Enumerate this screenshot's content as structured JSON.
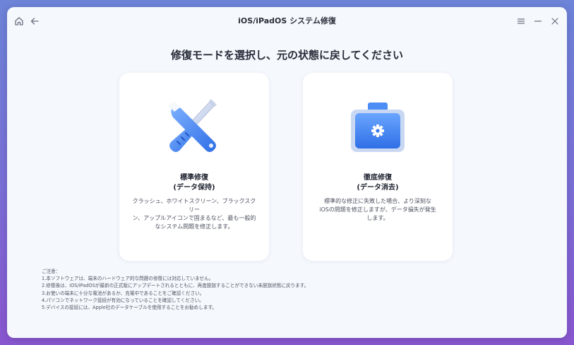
{
  "window": {
    "title": "iOS/iPadOS システム修復"
  },
  "main": {
    "heading": "修復モードを選択し、元の状態に戻してください"
  },
  "cards": [
    {
      "title_line1": "標準修復",
      "title_line2": "(データ保持)",
      "desc_line1": "クラッシュ、ホワイトスクリーン、ブラックスクリー",
      "desc_line2": "ン、アップルアイコンで固まるなど、最も一般的",
      "desc_line3": "なシステム問題を修正します。"
    },
    {
      "title_line1": "徹底修復",
      "title_line2": "(データ消去)",
      "desc_line1": "標準的な修正に失敗した場合、より深刻な",
      "desc_line2": "iOSの問題を修正しますが、データ損失が発生",
      "desc_line3": "します。"
    }
  ],
  "notes": {
    "header": "ご注意：",
    "items": [
      "1.本ソフトウェアは、端末のハードウェア的な問題の修復には対応していません。",
      "2.修復後は、iOS/iPadOSが最新の正式版にアップデートされるとともに、再度脱獄することができない未脱獄状態に戻ります。",
      "3.お使いの端末に十分な電池があるか、充電中であることをご確認ください。",
      "4.パソコンでネットワーク接続が有効になっていることを確認してください。",
      "5.デバイスの接続には、Apple社のデータケーブルを使用することをお勧めします。"
    ]
  },
  "colors": {
    "accent": "#3b7cf0",
    "background": "#f5f8fc"
  },
  "icons": {
    "home": "home-icon",
    "back": "back-arrow-icon",
    "menu": "menu-icon",
    "minimize": "minimize-icon",
    "close": "close-icon",
    "standard": "wrench-screwdriver-icon",
    "deep": "toolbox-gear-icon"
  }
}
